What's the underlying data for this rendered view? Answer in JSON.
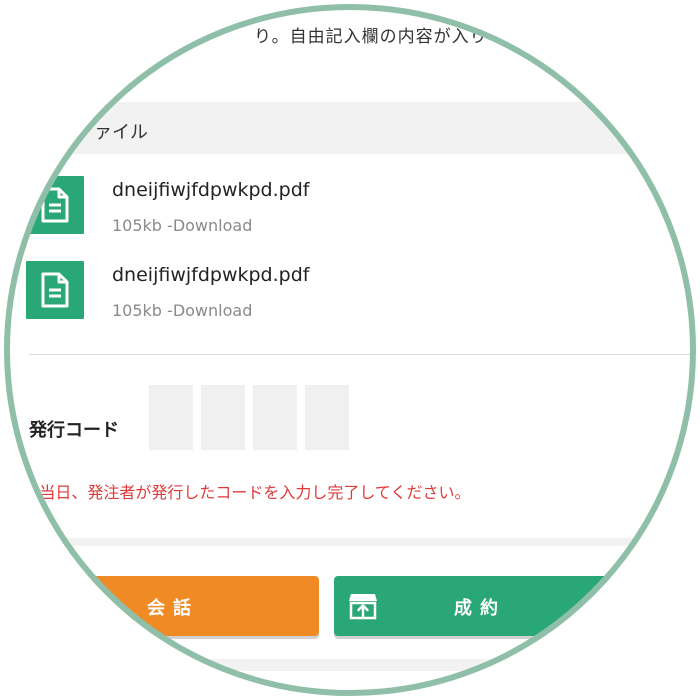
{
  "top_note": "り。自由記入欄の内容が入り",
  "attachments": {
    "header_label": "ァイル",
    "files": [
      {
        "name": "dneijfiwjfdpwkpd.pdf",
        "meta": "105kb -Download",
        "icon": "document-icon"
      },
      {
        "name": "dneijfiwjfdpwkpd.pdf",
        "meta": "105kb -Download",
        "icon": "document-icon"
      }
    ]
  },
  "issue_code": {
    "label": "発行コード",
    "digits": [
      "",
      "",
      "",
      ""
    ]
  },
  "warning": "※当日、発注者が発行したコードを入力し完了してください。",
  "actions": {
    "talk_label": "会話",
    "deal_label": "成約",
    "deal_icon": "upload-box-icon"
  },
  "colors": {
    "accent_green": "#2aa776",
    "accent_orange": "#ef8a25",
    "ring": "#8fbfa8",
    "warning_red": "#e03a3a"
  }
}
